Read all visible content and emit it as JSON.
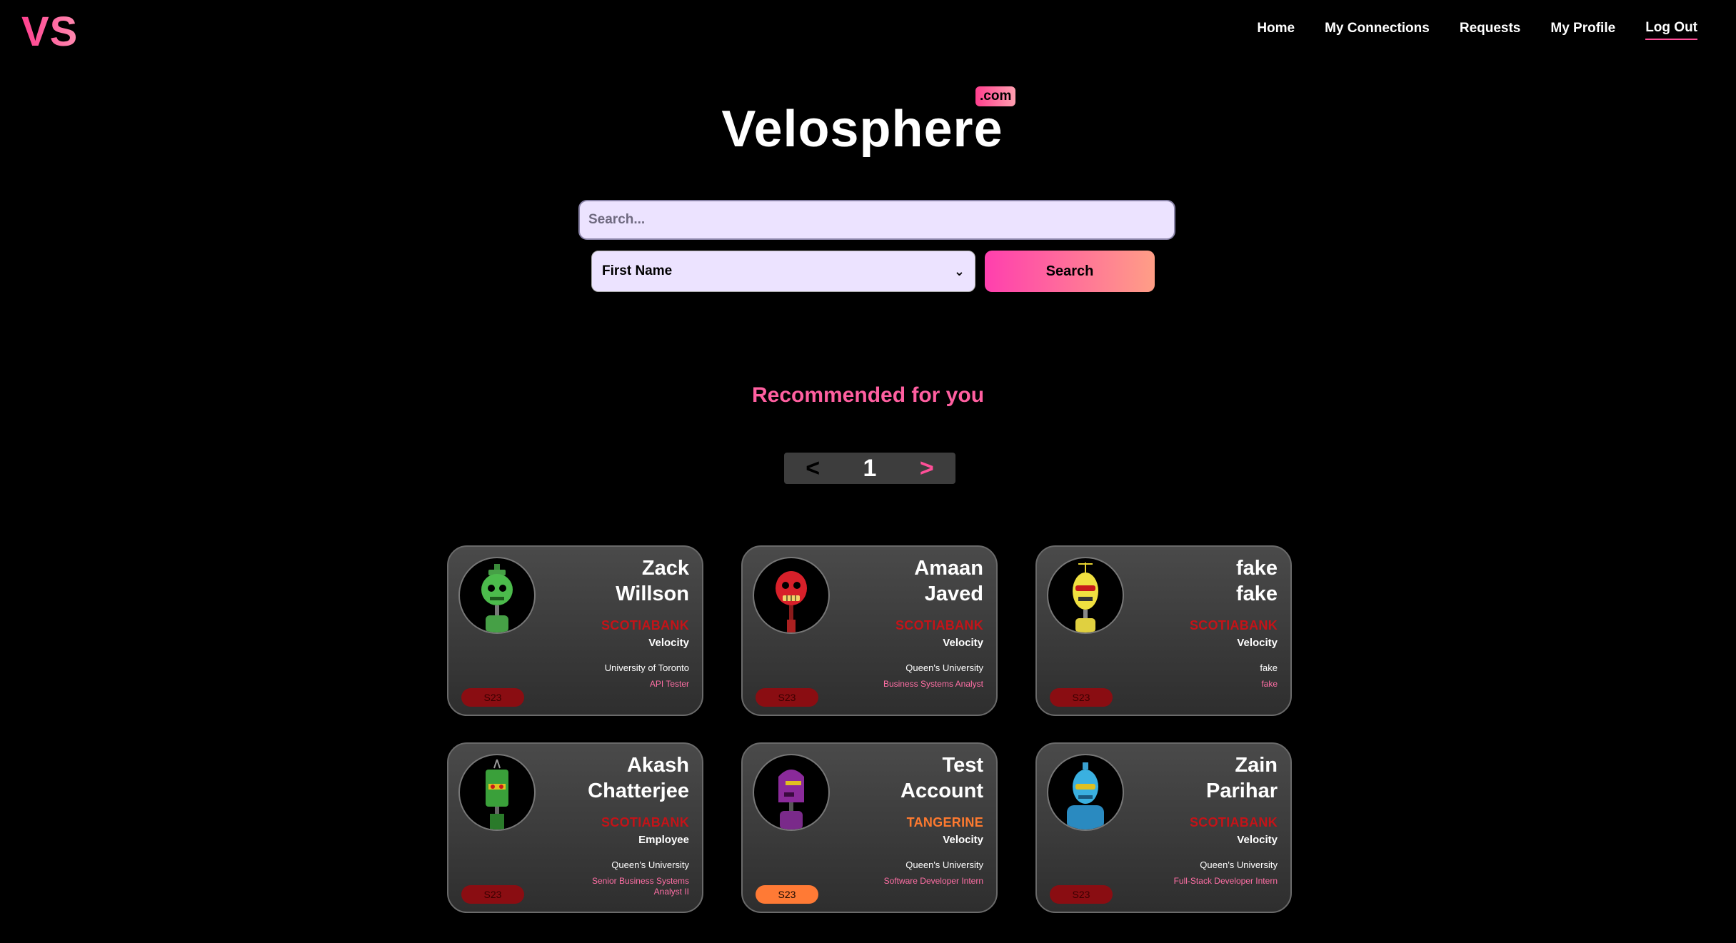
{
  "header": {
    "logo": "VS",
    "nav": [
      {
        "label": "Home"
      },
      {
        "label": "My Connections"
      },
      {
        "label": "Requests"
      },
      {
        "label": "My Profile"
      },
      {
        "label": "Log Out"
      }
    ]
  },
  "brand": {
    "title": "Velosphere",
    "tld": ".com"
  },
  "search": {
    "placeholder": "Search...",
    "filter_value": "First Name",
    "button_label": "Search"
  },
  "recommended": {
    "title": "Recommended for you"
  },
  "pagination": {
    "prev": "<",
    "page": "1",
    "next": ">"
  },
  "colors": {
    "accent": "#ff4f98",
    "scotiabank": "#c41318",
    "tangerine": "#ff7a2f",
    "input_bg": "#ece3ff"
  },
  "cards": [
    {
      "first": "Zack",
      "last": "Willson",
      "company": "SCOTIABANK",
      "team": "Velocity",
      "school": "University of Toronto",
      "role": "API Tester",
      "term": "S23",
      "avatar": "green-robot-icon"
    },
    {
      "first": "Amaan",
      "last": "Javed",
      "company": "SCOTIABANK",
      "team": "Velocity",
      "school": "Queen's University",
      "role": "Business Systems Analyst",
      "term": "S23",
      "avatar": "red-robot-icon"
    },
    {
      "first": "fake",
      "last": "fake",
      "company": "SCOTIABANK",
      "team": "Velocity",
      "school": "fake",
      "role": "fake",
      "term": "S23",
      "avatar": "yellow-robot-icon"
    },
    {
      "first": "Akash",
      "last": "Chatterjee",
      "company": "SCOTIABANK",
      "team": "Employee",
      "school": "Queen's University",
      "role": "Senior Business Systems Analyst II",
      "term": "S23",
      "avatar": "green-box-robot-icon"
    },
    {
      "first": "Test",
      "last": "Account",
      "company": "TANGERINE",
      "team": "Velocity",
      "school": "Queen's University",
      "role": "Software Developer Intern",
      "term": "S23",
      "avatar": "purple-robot-icon"
    },
    {
      "first": "Zain",
      "last": "Parihar",
      "company": "SCOTIABANK",
      "team": "Velocity",
      "school": "Queen's University",
      "role": "Full-Stack Developer Intern",
      "term": "S23",
      "avatar": "blue-robot-icon"
    }
  ]
}
